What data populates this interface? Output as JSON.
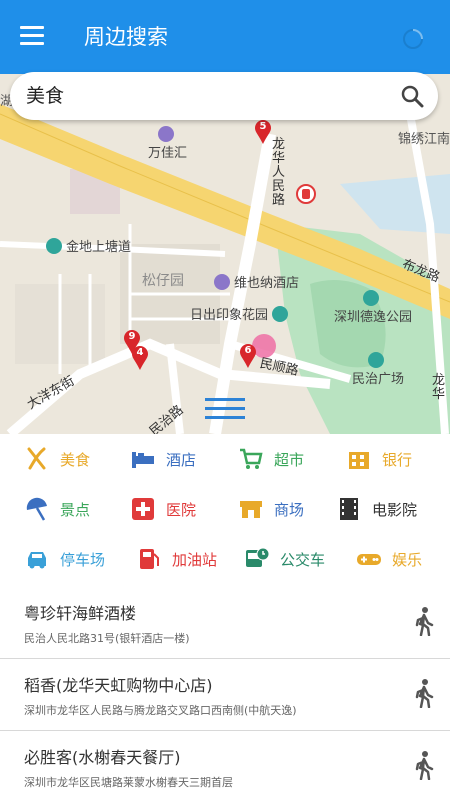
{
  "appbar": {
    "title": "周边搜索"
  },
  "search": {
    "query": "美食"
  },
  "map": {
    "labels": {
      "jinxiu": "锦绣江南",
      "wanjiahui": "万佳汇",
      "longhua_renmin_road": "龙华人民路",
      "bulong_road": "布龙路",
      "jindi": "金地上塘道",
      "songziyuan": "松仔园",
      "weiyena": "维也纳酒店",
      "richu": "日出印象花园",
      "deyi_park": "深圳德逸公园",
      "minshun_road": "民顺路",
      "minzhi_square": "民治广场",
      "dayang_east": "大洋东街",
      "minzhi_road": "民治路",
      "longhua_right": "龙华",
      "left_edge": "湖"
    },
    "markers": [
      "5",
      "9",
      "4",
      "6"
    ]
  },
  "categories": [
    {
      "label": "美食",
      "color": "#e8a92a"
    },
    {
      "label": "酒店",
      "color": "#3b6fc0"
    },
    {
      "label": "超市",
      "color": "#3aa65a"
    },
    {
      "label": "银行",
      "color": "#e8a92a"
    },
    {
      "label": "景点",
      "color": "#3aa65a"
    },
    {
      "label": "医院",
      "color": "#e03a3a"
    },
    {
      "label": "商场",
      "color": "#3b6fc0"
    },
    {
      "label": "电影院",
      "color": "#333333"
    },
    {
      "label": "停车场",
      "color": "#3aa0d8"
    },
    {
      "label": "加油站",
      "color": "#e03a3a"
    },
    {
      "label": "公交车",
      "color": "#2a8a6a"
    },
    {
      "label": "娱乐",
      "color": "#e8a92a"
    }
  ],
  "results": [
    {
      "name": "粤珍轩海鲜酒楼",
      "address": "民治人民北路31号(银轩酒店一楼)"
    },
    {
      "name": "稻香(龙华天虹购物中心店)",
      "address": "深圳市龙华区人民路与腾龙路交叉路口西南侧(中航天逸)"
    },
    {
      "name": "必胜客(水榭春天餐厅)",
      "address": "深圳市龙华区民塘路莱蒙水榭春天三期首层"
    }
  ]
}
